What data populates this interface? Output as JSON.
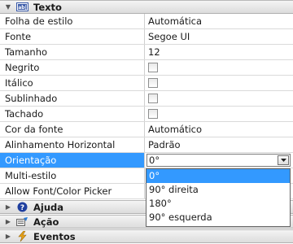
{
  "sections": {
    "texto": "Texto",
    "ajuda": "Ajuda",
    "acao": "Ação",
    "eventos": "Eventos"
  },
  "properties": [
    {
      "label": "Folha de estilo",
      "value": "Automática"
    },
    {
      "label": "Fonte",
      "value": "Segoe UI"
    },
    {
      "label": "Tamanho",
      "value": "12"
    },
    {
      "label": "Negrito",
      "checkbox": true,
      "checked": false
    },
    {
      "label": "Itálico",
      "checkbox": true,
      "checked": false
    },
    {
      "label": "Sublinhado",
      "checkbox": true,
      "checked": false
    },
    {
      "label": "Tachado",
      "checkbox": true,
      "checked": false
    },
    {
      "label": "Cor da fonte",
      "value": "Automático"
    },
    {
      "label": "Alinhamento Horizontal",
      "value": "Padrão"
    },
    {
      "label": "Orientação",
      "value": "0°",
      "selected": true
    },
    {
      "label": "Multi-estilo",
      "value": ""
    },
    {
      "label": "Allow Font/Color Picker",
      "value": ""
    }
  ],
  "orientation_options": [
    "0°",
    "90° direita",
    "180°",
    "90° esquerda"
  ],
  "orientation_selected": "0°",
  "icons": {
    "texto": "text-field-icon",
    "ajuda": "help-icon",
    "acao": "action-icon",
    "eventos": "lightning-icon"
  },
  "colors": {
    "selection": "#3399ff",
    "help_icon": "#1f3f9f",
    "events_icon": "#e8a317"
  }
}
